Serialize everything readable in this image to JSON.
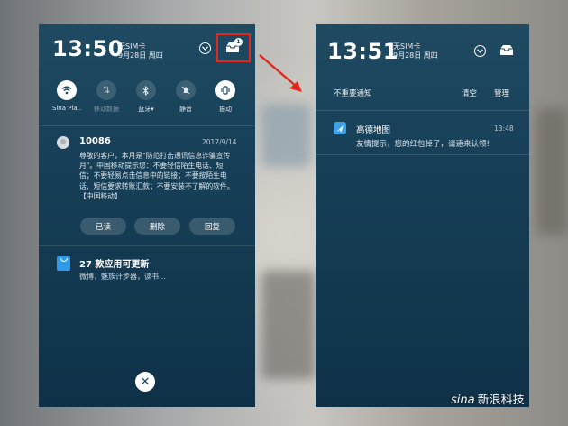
{
  "left_screen": {
    "time": "13:50",
    "sim_status": "无SIM卡",
    "date": "9月28日 周四",
    "badge_count": "1",
    "quick_settings": [
      {
        "label": "Sina Pla..",
        "icon": "wifi-icon",
        "active": true
      },
      {
        "label": "移动数据",
        "icon": "mobile-data-icon",
        "active": false
      },
      {
        "label": "蓝牙▾",
        "icon": "bluetooth-icon",
        "active": false
      },
      {
        "label": "静音",
        "icon": "mute-icon",
        "active": false
      },
      {
        "label": "振动",
        "icon": "vibrate-icon",
        "active": true
      }
    ],
    "sms": {
      "sender": "10086",
      "date": "2017/9/14",
      "body": "尊敬的客户，本月是\"防范打击通讯信息诈骗宣传月\"。中国移动提示您：不要轻信陌生电话、短信；不要轻易点击信息中的链接；不要按陌生电话、短信要求转账汇款；不要安装不了解的软件。【中国移动】",
      "actions": [
        "已读",
        "删除",
        "回复"
      ]
    },
    "app_update": {
      "title": "27 款应用可更新",
      "subtitle": "微博，魅族计步器，读书..."
    },
    "close_icon": "close-icon"
  },
  "right_screen": {
    "time": "13:51",
    "sim_status": "无SIM卡",
    "date": "9月28日 周四",
    "header_title": "不重要通知",
    "clear_label": "清空",
    "manage_label": "管理",
    "notification": {
      "app": "高德地图",
      "time": "13:48",
      "body": "友情提示，您的红包掉了，请速来认领!"
    }
  },
  "colors": {
    "highlight": "#e1271e",
    "panel": "#174058"
  },
  "watermark": {
    "brand": "sina",
    "text": "新浪科技"
  }
}
